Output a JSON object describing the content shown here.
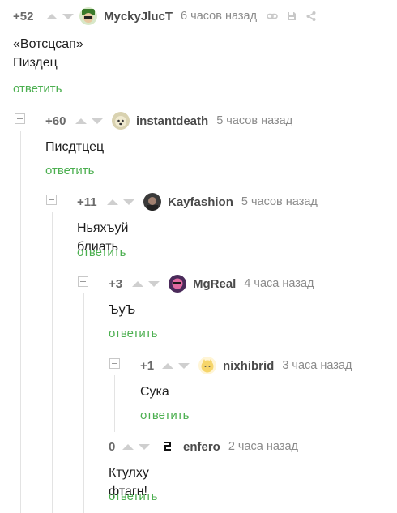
{
  "comments": [
    {
      "rating": "+52",
      "author": "MyckyJlucT",
      "time": "6 часов назад",
      "text_lines": [
        "«Вотсцсап»",
        "Пиздец"
      ],
      "reply": "ответить",
      "avatar": "green-hat-avatar"
    },
    {
      "rating": "+60",
      "author": "instantdeath",
      "time": "5 часов назад",
      "text_lines": [
        "Писдтцец"
      ],
      "reply": "ответить",
      "avatar": "dog-avatar"
    },
    {
      "rating": "+11",
      "author": "Kayfashion",
      "time": "5 часов назад",
      "text_lines": [
        "Ньяхъуй блиать"
      ],
      "reply": "ответить",
      "avatar": "dark-person-avatar"
    },
    {
      "rating": "+3",
      "author": "MgReal",
      "time": "4 часа назад",
      "text_lines": [
        "ЪуЪ"
      ],
      "reply": "ответить",
      "avatar": "pink-face-avatar"
    },
    {
      "rating": "+1",
      "author": "nixhibrid",
      "time": "3 часа назад",
      "text_lines": [
        "Сука"
      ],
      "reply": "ответить",
      "avatar": "yellow-cat-avatar"
    },
    {
      "rating": "0",
      "author": "enfero",
      "time": "2 часа назад",
      "text_lines": [
        "Ктулху фтагн!"
      ],
      "reply": "ответить",
      "avatar": "glyph-avatar"
    }
  ],
  "colors": {
    "reply_green": "#4caf50",
    "rating_gray": "#6b6b6b",
    "author_gray": "#4a4a4a",
    "time_gray": "#8b8b8b",
    "vote_arrow": "#cfcfcf"
  },
  "icons": [
    "link-icon",
    "save-icon",
    "share-icon",
    "upvote-icon",
    "downvote-icon",
    "collapse-icon"
  ]
}
